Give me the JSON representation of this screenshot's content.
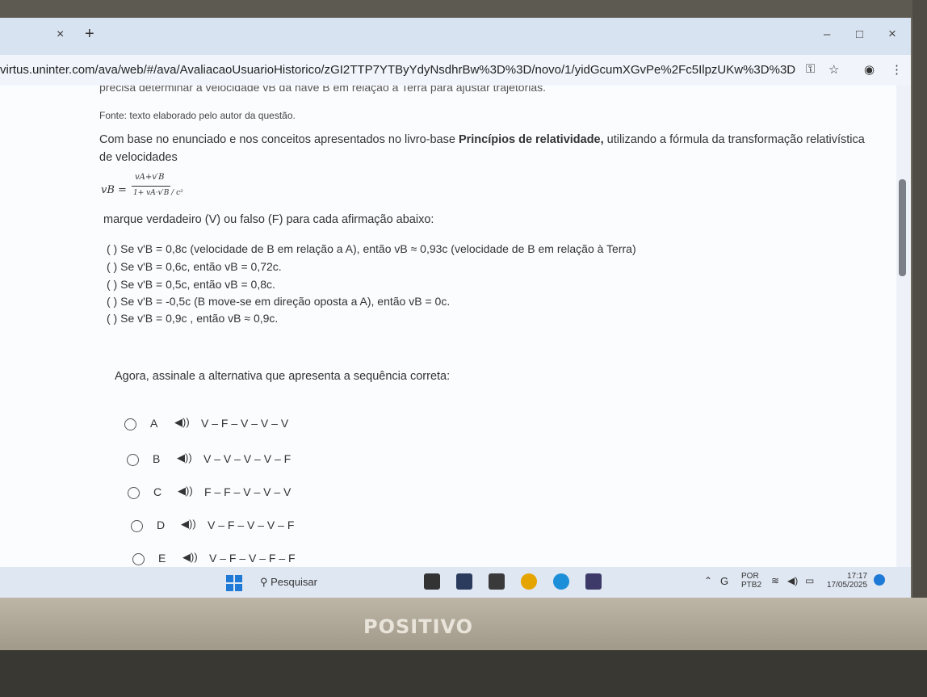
{
  "browser": {
    "tab_close": "×",
    "new_tab": "+",
    "url": "virtus.uninter.com/ava/web/#/ava/AvaliacaoUsuarioHistorico/zGI2TTP7YTByYdyNsdhrBw%3D%3D/novo/1/yidGcumXGvPe%2Fc5IlpzUKw%3D%3D",
    "minimize": "–",
    "maximize": "□",
    "close": "×"
  },
  "question": {
    "cut_line": "precisa determinar a velocidade vB da nave B em relação à Terra para ajustar trajetórias.",
    "source": "Fonte: texto elaborado pelo autor da questão.",
    "intro_before": "Com base no enunciado e nos conceitos apresentados no livro-base ",
    "intro_bold": "Princípios de relatividade,",
    "intro_after": " utilizando a fórmula da transformação relativística de velocidades",
    "formula_lhs": "vB =",
    "formula_num": "vA+v′B",
    "formula_den": "1+ vA·v′B / c²",
    "instruction": "marque verdadeiro (V) ou falso (F) para cada afirmação abaixo:",
    "statements": [
      "( ) Se  v'B = 0,8c  (velocidade de B em relação a A), então  vB ≈ 0,93c  (velocidade de B em relação à Terra)",
      "( ) Se  v'B = 0,6c, então  vB = 0,72c.",
      "( ) Se  v'B = 0,5c, então  vB = 0,8c.",
      "( ) Se  v'B = -0,5c  (B move-se em direção oposta a A), então  vB = 0c.",
      "( ) Se  v'B = 0,9c , então  vB ≈ 0,9c."
    ],
    "prompt": "Agora, assinale a alternativa que apresenta a sequência correta:",
    "options": [
      {
        "letter": "A",
        "sequence": "V – F – V – V – V"
      },
      {
        "letter": "B",
        "sequence": "V – V – V – V – F"
      },
      {
        "letter": "C",
        "sequence": "F – F – V – V – V"
      },
      {
        "letter": "D",
        "sequence": "V – F – V – V – F"
      },
      {
        "letter": "E",
        "sequence": "V – F – V – F – F"
      }
    ],
    "speaker_icon": "◀))"
  },
  "taskbar": {
    "search_label": "Pesquisar",
    "lang_1": "POR",
    "lang_2": "PTB2",
    "time": "17:17",
    "date": "17/05/2025"
  },
  "laptop": {
    "brand": "POSITIVO"
  },
  "colors": {
    "accent": "#1f79d6",
    "page_bg": "#fbfcfe",
    "chrome_bg": "#d8e3f1"
  }
}
